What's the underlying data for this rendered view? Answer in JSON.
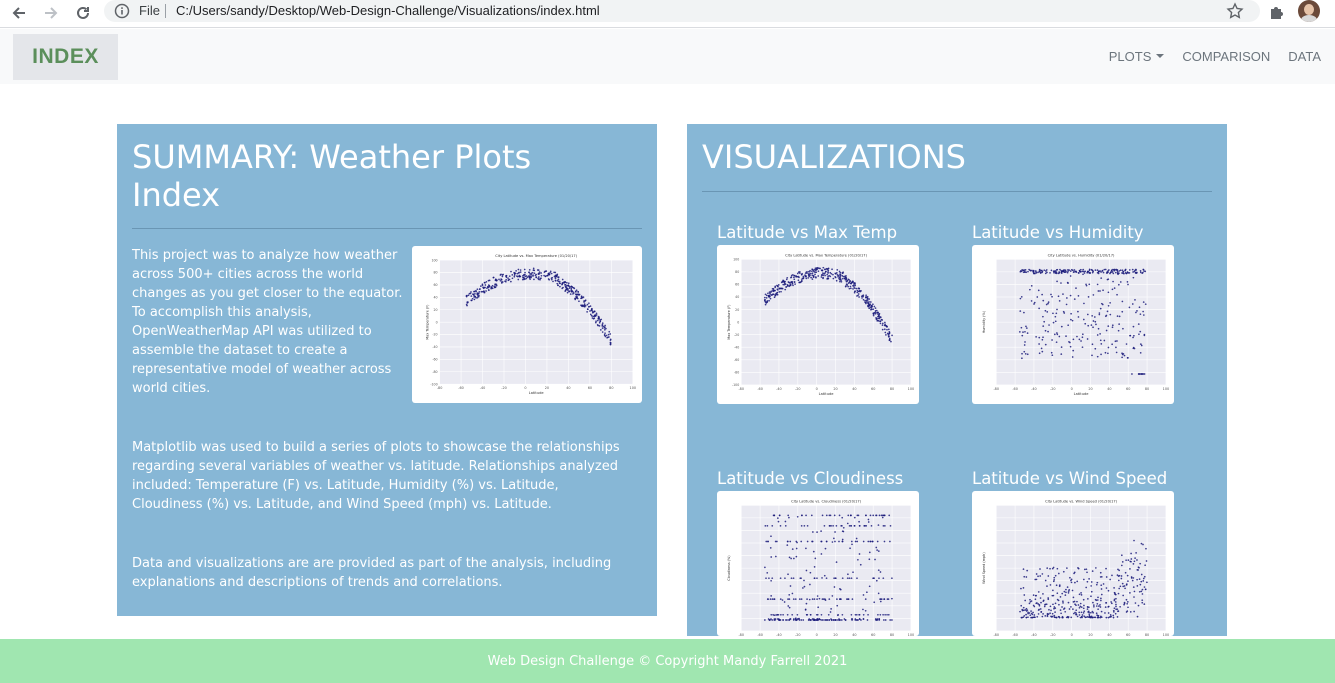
{
  "browser": {
    "file_label": "File",
    "url": "C:/Users/sandy/Desktop/Web-Design-Challenge/Visualizations/index.html"
  },
  "navbar": {
    "brand": "INDEX",
    "links": [
      "PLOTS",
      "COMPARISON",
      "DATA"
    ]
  },
  "summary": {
    "title": "SUMMARY: Weather Plots Index",
    "para1": [
      "This project was to analyze how weather",
      "across 500+ cities across the world",
      "changes as you get closer to the equator.",
      "To accomplish this analysis,",
      "OpenWeatherMap API was utilized to",
      "assemble the dataset to create a",
      "representative model of weather across",
      "world cities."
    ],
    "para2": [
      "Matplotlib was used to build a series of plots to showcase the relationships",
      "regarding several variables of weather vs. latitude. Relationships analyzed",
      "included: Temperature (F) vs. Latitude, Humidity (%) vs. Latitude,",
      "Cloudiness (%) vs. Latitude, and Wind Speed (mph) vs. Latitude."
    ],
    "para3": [
      "Data and visualizations are are provided as part of the analysis, including",
      "explanations and descriptions of trends and correlations."
    ]
  },
  "visualizations": {
    "title": "VISUALIZATIONS",
    "items": [
      {
        "label": "Latitude vs Max Temp",
        "plot_title": "City Latitude vs. Max Temperature (01/20/17)",
        "ylabel": "Max Temperature (F)"
      },
      {
        "label": "Latitude vs Humidity",
        "plot_title": "City Latitude vs. Humidity (01/20/17)",
        "ylabel": "Humidity (%)"
      },
      {
        "label": "Latitude vs Cloudiness",
        "plot_title": "City Latitude vs. Cloudiness (01/20/17)",
        "ylabel": "Cloudiness (%)"
      },
      {
        "label": "Latitude vs Wind Speed",
        "plot_title": "City Latitude vs. Wind Speed (01/20/17)",
        "ylabel": "Wind Speed (mph)"
      }
    ]
  },
  "thumbnail_axes": {
    "xlabel": "Latitude",
    "xticks": [
      "-80",
      "-60",
      "-40",
      "-20",
      "0",
      "20",
      "40",
      "60",
      "80",
      "100"
    ],
    "temp_yticks": [
      "100",
      "80",
      "60",
      "40",
      "20",
      "0",
      "-20",
      "-40",
      "-60",
      "-80",
      "-100"
    ]
  },
  "footer": {
    "text": "Web Design Challenge © Copyright Mandy Farrell 2021"
  },
  "colors": {
    "panel": "#87b7d6",
    "footer": "#a0e6b0",
    "brand": "#5b8f5b",
    "points": "#1a1a7a"
  }
}
